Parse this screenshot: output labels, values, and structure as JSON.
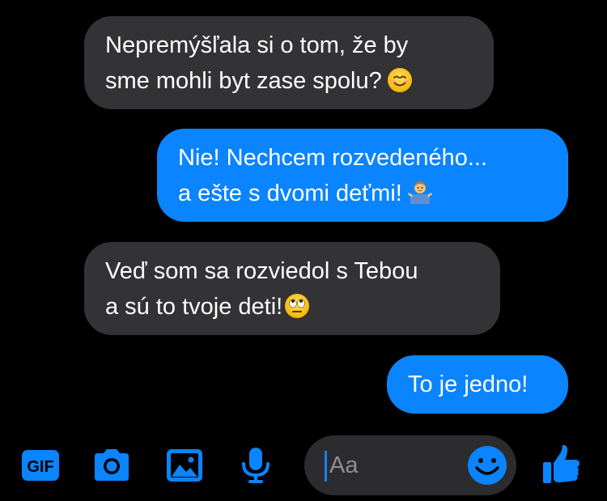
{
  "messages": [
    {
      "direction": "incoming",
      "lines": [
        "Nepremýšľala si o tom, že by",
        "sme mohli byt zase spolu?"
      ],
      "emoji": "smiling-face-emoji"
    },
    {
      "direction": "outgoing",
      "lines": [
        "Nie! Nechcem rozvedeného...",
        "a ešte s dvomi deťmi!"
      ],
      "emoji": "man-shrugging-emoji"
    },
    {
      "direction": "incoming",
      "lines": [
        "Veď som sa rozviedol s Tebou",
        "a sú to tvoje deti!"
      ],
      "emoji": "eye-roll-emoji"
    },
    {
      "direction": "outgoing",
      "lines": [
        "To je jedno!"
      ]
    }
  ],
  "composer": {
    "placeholder": "Aa",
    "gif_label": "GIF",
    "icons": [
      "gif-icon",
      "camera-icon",
      "image-icon",
      "microphone-icon",
      "smiley-icon",
      "thumbs-up-icon"
    ]
  },
  "colors": {
    "background": "#000000",
    "incoming_bubble": "#333335",
    "outgoing_bubble": "#0a84ff",
    "accent": "#0a84ff",
    "composer_bg": "#2c2c2e"
  }
}
